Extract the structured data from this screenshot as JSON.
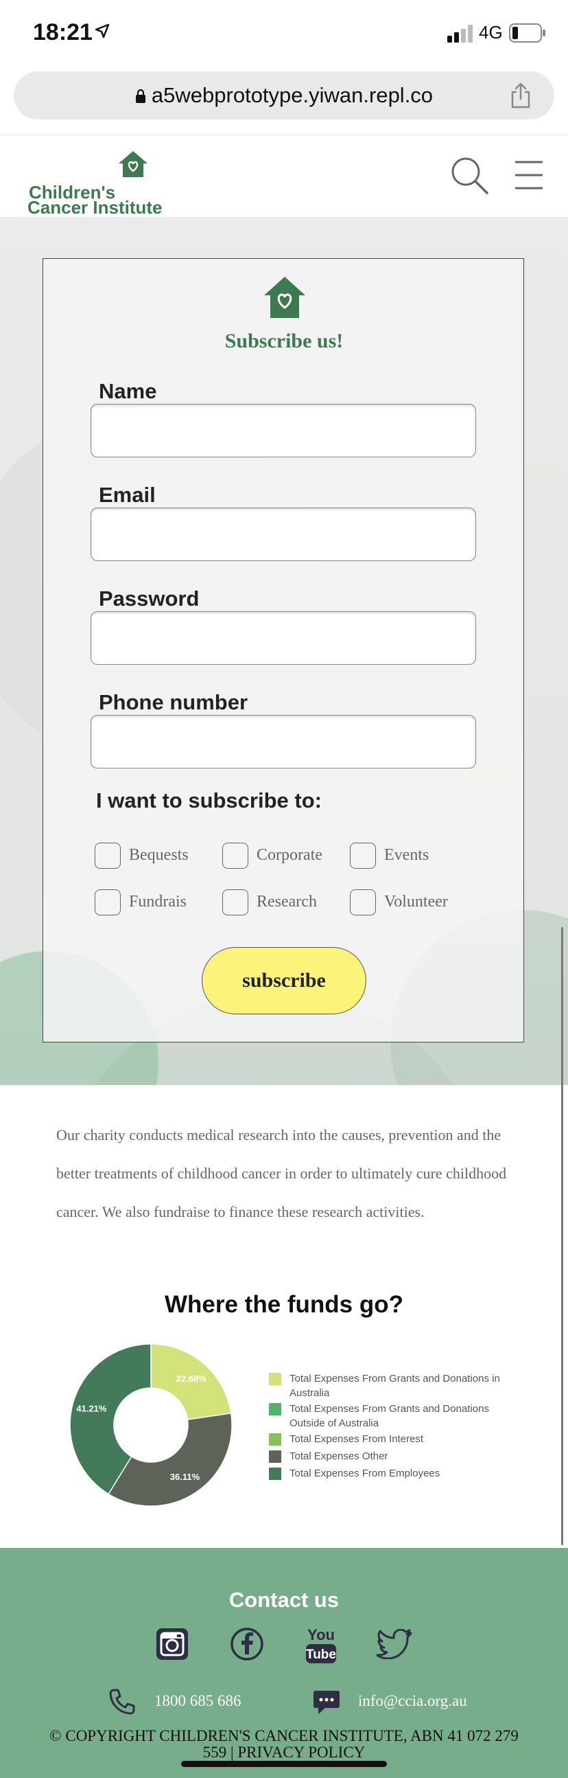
{
  "status_bar": {
    "time": "18:21",
    "network": "4G",
    "location-icon": "location-arrow-icon"
  },
  "browser": {
    "url": "a5webprototype.yiwan.repl.co"
  },
  "header": {
    "logo_line1": "Children's",
    "logo_line2": "Cancer Institute"
  },
  "form": {
    "title": "Subscribe us!",
    "name_label": "Name",
    "email_label": "Email",
    "password_label": "Password",
    "phone_label": "Phone number",
    "subscribe_to_label": "I want to subscribe to:",
    "options": [
      "Bequests",
      "Corporate",
      "Events",
      "Fundrais",
      "Research",
      "Volunteer"
    ],
    "submit_label": "subscribe"
  },
  "about": {
    "text": "Our charity conducts medical research into the causes, prevention and the better treatments of childhood cancer in order to ultimately cure childhood cancer. We also fundraise to finance these research activities."
  },
  "chart_data": {
    "type": "pie",
    "title": "Where the funds go?",
    "labels": [
      "Total Expenses From Grants and Donations in Australia",
      "Total Expenses From Grants and Donations Outside of Australia",
      "Total Expenses From Interest",
      "Total Expenses Other",
      "Total Expenses From Employees"
    ],
    "values": [
      22.68,
      0,
      0,
      36.11,
      41.21
    ],
    "data_labels": [
      "22.68%",
      "",
      "",
      "36.11%",
      "41.21%"
    ],
    "colors": [
      "#d3e27a",
      "#52b36b",
      "#86c25a",
      "#5e6359",
      "#427a5a"
    ],
    "legend_position": "right"
  },
  "footer": {
    "title": "Contact us",
    "phone": "1800 685 686",
    "email": "info@ccia.org.au",
    "copyright_line1": "© COPYRIGHT CHILDREN'S CANCER INSTITUTE, ABN 41 072 279",
    "copyright_line2": "559 | PRIVACY POLICY",
    "social": [
      "instagram-icon",
      "facebook-icon",
      "youtube-icon",
      "twitter-icon"
    ]
  },
  "colors": {
    "brand_green": "#3d7a4f",
    "footer_green": "#77ad8a",
    "button_yellow": "#fbf37a"
  }
}
